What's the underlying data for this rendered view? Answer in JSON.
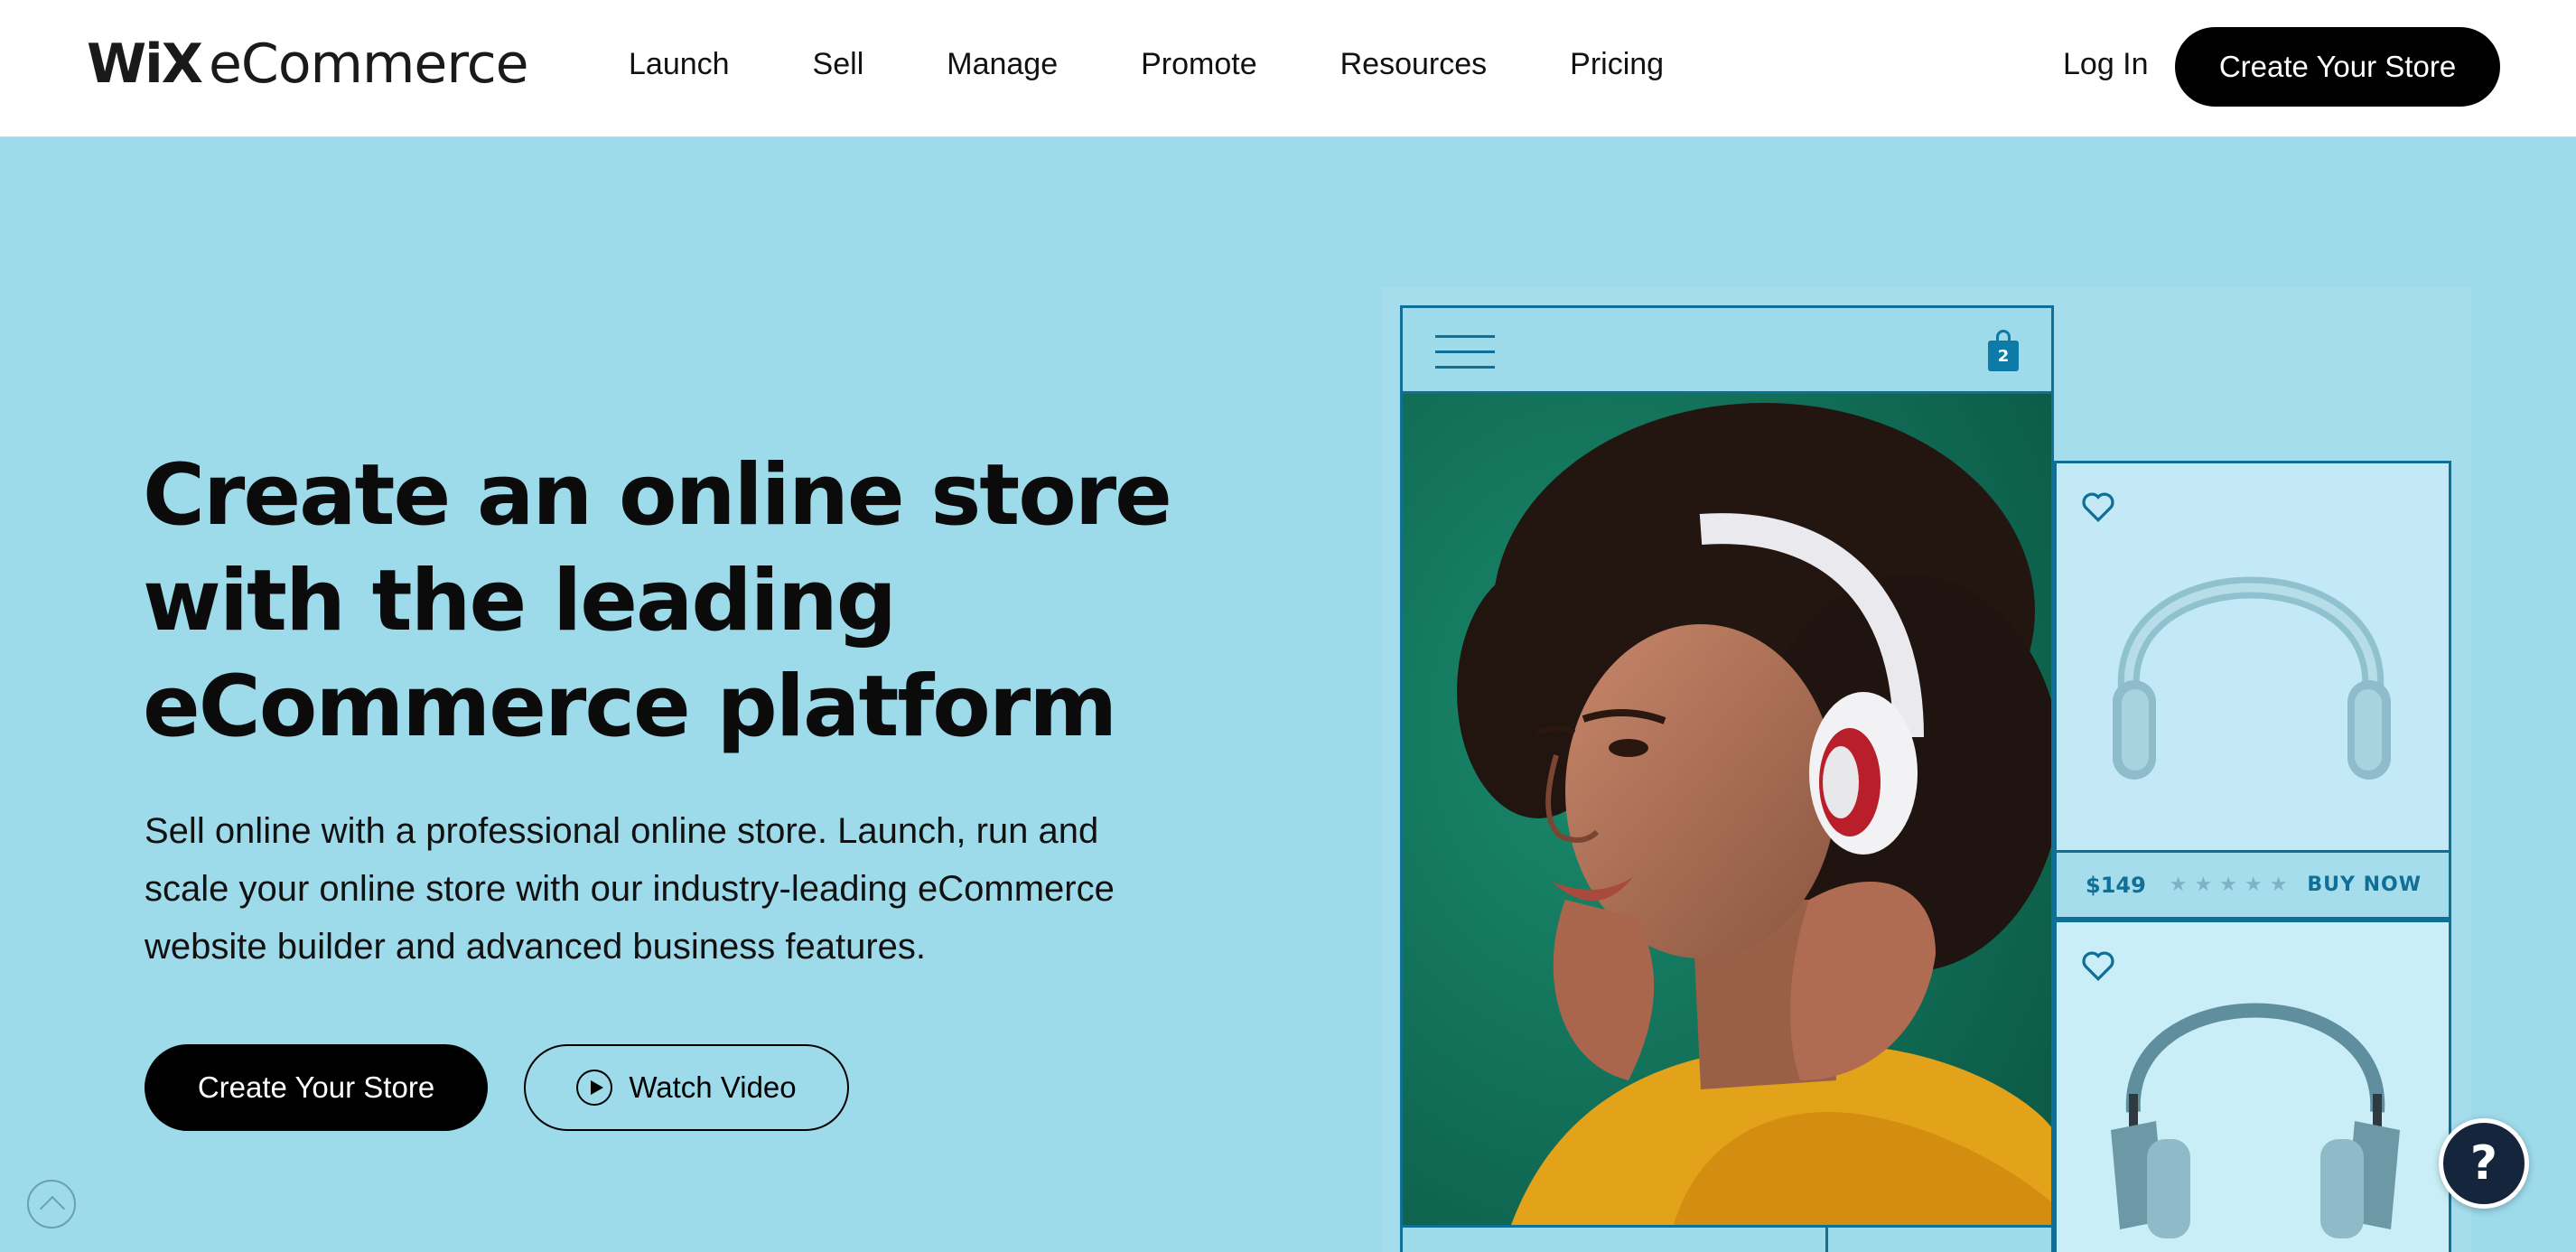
{
  "header": {
    "logo_wix": "WiX",
    "logo_product": "eCommerce",
    "nav": [
      "Launch",
      "Sell",
      "Manage",
      "Promote",
      "Resources",
      "Pricing"
    ],
    "login": "Log In",
    "cta": "Create Your Store"
  },
  "hero": {
    "title_lines": [
      "Create an online store",
      "with the leading",
      "eCommerce platform"
    ],
    "subtitle_lines": [
      "Sell online with a professional online store. Launch, run and",
      "scale your online store with our industry-leading eCommerce",
      "website builder and advanced business features."
    ],
    "primary_cta": "Create Your Store",
    "video_cta": "Watch Video"
  },
  "mockup": {
    "cart_count": "2",
    "product": {
      "price": "$149",
      "stars": "★★★★★",
      "rating": 0,
      "buy_label": "BUY NOW"
    }
  },
  "help": {
    "label": "?"
  },
  "colors": {
    "background": "#9ddaea",
    "accent": "#0f6f96",
    "button": "#000000",
    "help": "#15253c"
  }
}
